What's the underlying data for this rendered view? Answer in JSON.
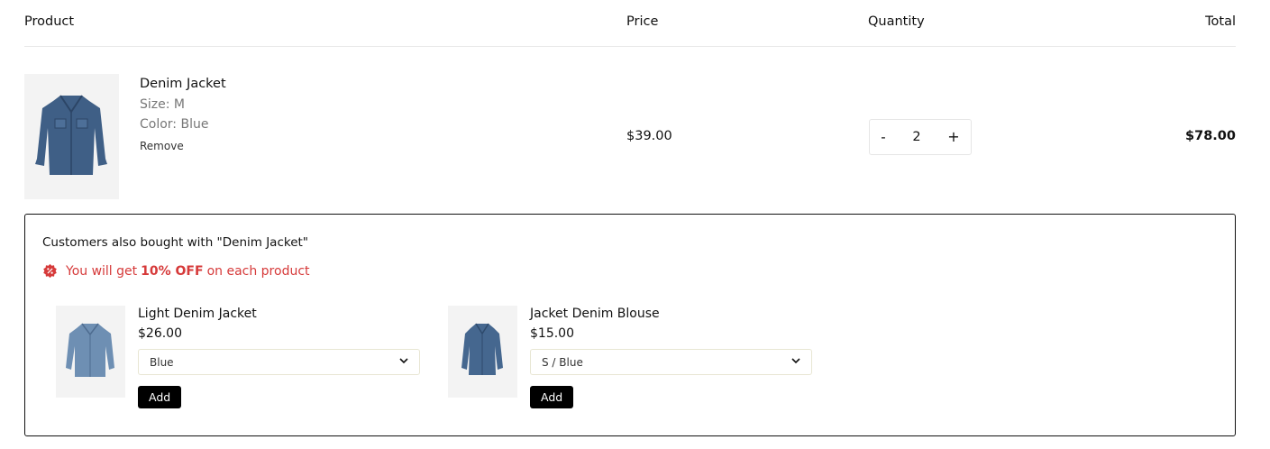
{
  "header": {
    "product": "Product",
    "price": "Price",
    "quantity": "Quantity",
    "total": "Total"
  },
  "cart_item": {
    "name": "Denim Jacket",
    "size": "Size: M",
    "color": "Color: Blue",
    "remove": "Remove",
    "price": "$39.00",
    "quantity": "2",
    "minus": "-",
    "plus": "+",
    "total": "$78.00"
  },
  "frequently_bought": {
    "title": "Customers also bought with \"Denim Jacket\"",
    "offer_prefix": "You will get",
    "offer_highlight": "10% OFF",
    "offer_suffix": "on each product",
    "accent_color": "#d63a3a",
    "products": [
      {
        "name": "Light Denim Jacket",
        "price": "$26.00",
        "variant": "Blue",
        "add_label": "Add"
      },
      {
        "name": "Jacket Denim Blouse",
        "price": "$15.00",
        "variant": "S / Blue",
        "add_label": "Add"
      }
    ]
  }
}
